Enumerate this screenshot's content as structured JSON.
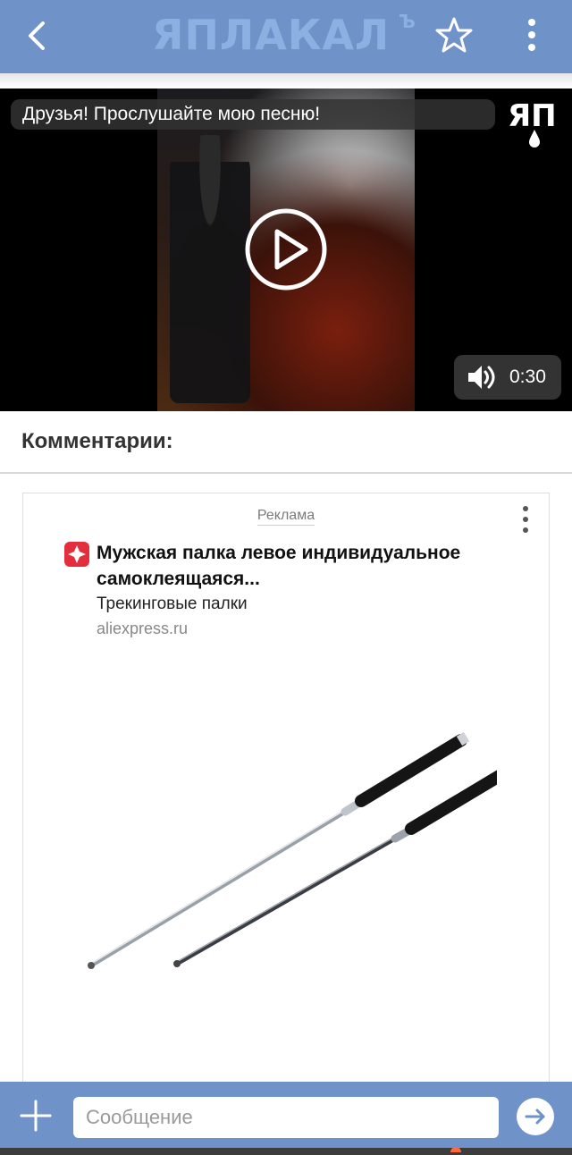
{
  "app": {
    "logo_text": "ЯПЛАКАЛ",
    "logo_sup": "Ъ",
    "icons": [
      "back-icon",
      "star-icon",
      "more-vert-icon"
    ]
  },
  "video": {
    "title": "Друзья! Прослушайте мою песню!",
    "watermark": "ЯП",
    "duration": "0:30",
    "icons": [
      "play-icon",
      "volume-icon"
    ]
  },
  "comments": {
    "title": "Комментарии:"
  },
  "ad": {
    "label": "Реклама",
    "title": "Мужская палка левое индивидуальное самоклеящаяся...",
    "subtitle": "Трекинговые палки",
    "domain": "aliexpress.ru",
    "brand_color": "#e52e3d",
    "image_alt": "two telescopic batons"
  },
  "composer": {
    "placeholder": "Сообщение",
    "icons": [
      "plus-icon",
      "send-icon"
    ]
  },
  "colors": {
    "bar": "#6f92c9",
    "accent": "#6f92c9"
  }
}
